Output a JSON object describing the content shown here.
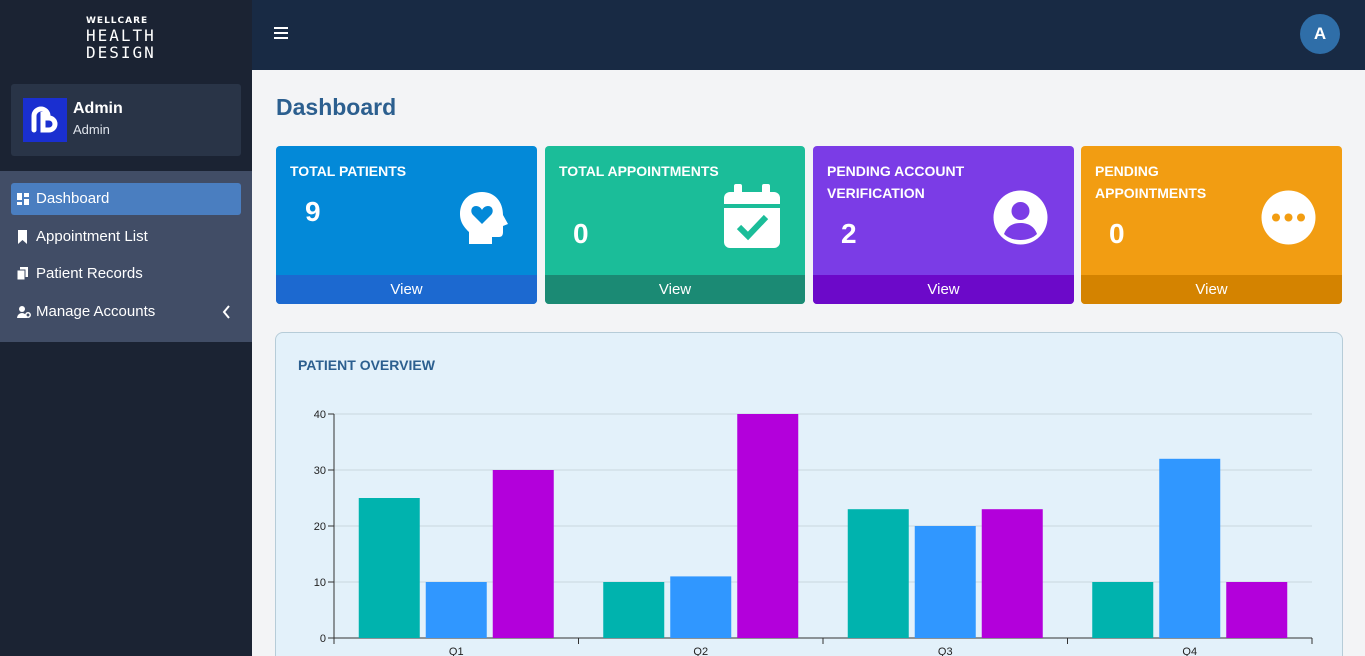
{
  "brand": {
    "line1": "WELLCARE",
    "line2": "HEALTH",
    "line3": "DESIGN"
  },
  "user": {
    "name": "Admin",
    "role": "Admin"
  },
  "nav": {
    "items": [
      {
        "label": "Dashboard",
        "icon": "dashboard-icon",
        "active": true
      },
      {
        "label": "Appointment List",
        "icon": "bookmark-icon"
      },
      {
        "label": "Patient Records",
        "icon": "copy-icon"
      },
      {
        "label": "Manage Accounts",
        "icon": "users-cog-icon"
      }
    ]
  },
  "topbar": {
    "avatar_letter": "A"
  },
  "page": {
    "title": "Dashboard"
  },
  "cards": [
    {
      "label": "TOTAL PATIENTS",
      "value": "9",
      "link": "View",
      "icon": "head-heart-icon",
      "color": "#0389d8",
      "footer_color": "#1c69d0"
    },
    {
      "label": "TOTAL APPOINTMENTS",
      "value": "0",
      "link": "View",
      "icon": "calendar-check-icon",
      "color": "#1bbd99",
      "footer_color": "#1b8a74"
    },
    {
      "label": "PENDING ACCOUNT VERIFICATION",
      "value": "2",
      "link": "View",
      "icon": "user-circle-icon",
      "color": "#7b3ce6",
      "footer_color": "#6c09c9"
    },
    {
      "label": "PENDING APPOINTMENTS",
      "value": "0",
      "link": "View",
      "icon": "ellipsis-circle-icon",
      "color": "#f29d12",
      "footer_color": "#d48300"
    }
  ],
  "chart_panel": {
    "title": "PATIENT OVERVIEW"
  },
  "chart_data": {
    "type": "bar",
    "categories": [
      "Q1",
      "Q2",
      "Q3",
      "Q4"
    ],
    "series": [
      {
        "values": [
          25,
          10,
          23,
          10
        ],
        "color": "#00b3ae"
      },
      {
        "values": [
          10,
          11,
          20,
          32
        ],
        "color": "#3097ff"
      },
      {
        "values": [
          30,
          40,
          23,
          10
        ],
        "color": "#b300db"
      }
    ],
    "ylim": [
      0,
      40
    ],
    "yticks": [
      0,
      10,
      20,
      30,
      40
    ],
    "grid": true
  }
}
